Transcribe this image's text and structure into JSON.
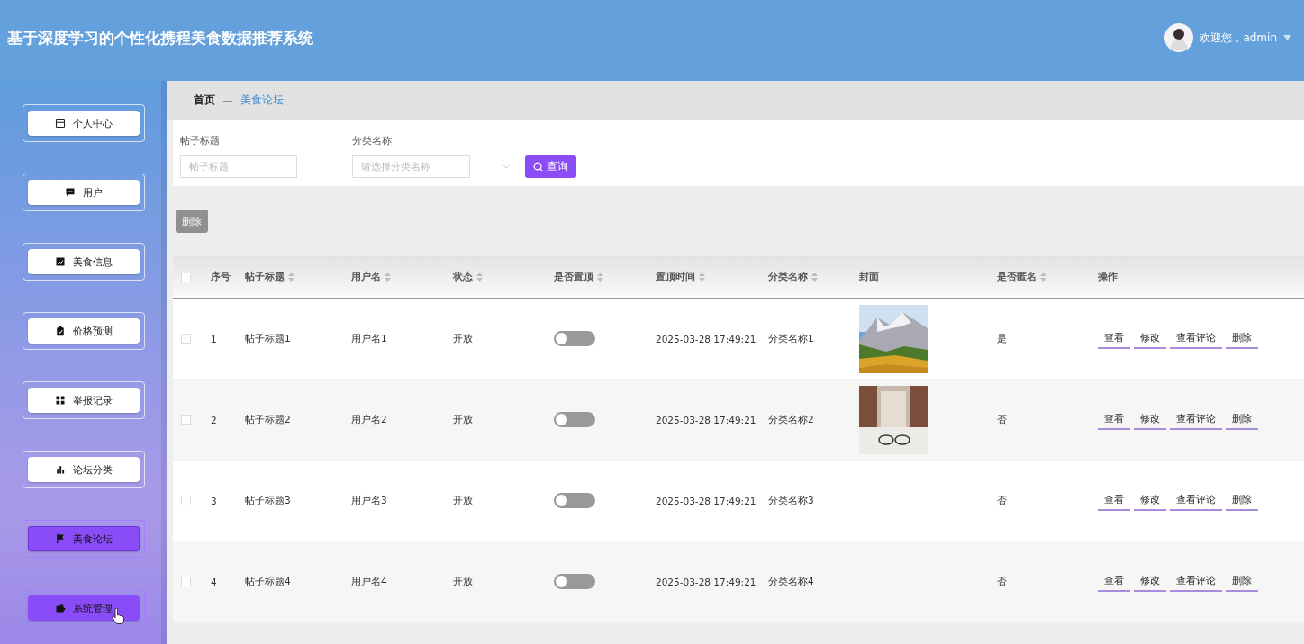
{
  "header": {
    "title": "基于深度学习的个性化携程美食数据推荐系统",
    "greeting": "欢迎您，admin"
  },
  "sidebar": {
    "items": [
      {
        "label": "个人中心",
        "selected": false,
        "hovered": false
      },
      {
        "label": "用户",
        "selected": false,
        "hovered": false
      },
      {
        "label": "美食信息",
        "selected": false,
        "hovered": false
      },
      {
        "label": "价格预测",
        "selected": false,
        "hovered": false
      },
      {
        "label": "举报记录",
        "selected": false,
        "hovered": false
      },
      {
        "label": "论坛分类",
        "selected": false,
        "hovered": false
      },
      {
        "label": "美食论坛",
        "selected": true,
        "hovered": false
      },
      {
        "label": "系统管理",
        "selected": false,
        "hovered": true
      }
    ]
  },
  "breadcrumb": {
    "home": "首页",
    "separator": "—",
    "current": "美食论坛"
  },
  "search": {
    "fields": [
      {
        "label": "帖子标题",
        "placeholder": "帖子标题",
        "kind": "input"
      },
      {
        "label": "分类名称",
        "placeholder": "请选择分类名称",
        "kind": "select"
      }
    ],
    "button": "查询"
  },
  "delete_button": "删除",
  "table": {
    "all_checked": false,
    "columns": [
      {
        "label": "序号",
        "sortable": false
      },
      {
        "label": "帖子标题",
        "sortable": true
      },
      {
        "label": "用户名",
        "sortable": true
      },
      {
        "label": "状态",
        "sortable": true
      },
      {
        "label": "是否置顶",
        "sortable": true
      },
      {
        "label": "置顶时间",
        "sortable": true
      },
      {
        "label": "分类名称",
        "sortable": true
      },
      {
        "label": "封面",
        "sortable": false
      },
      {
        "label": "是否匿名",
        "sortable": true
      },
      {
        "label": "操作",
        "sortable": false
      }
    ],
    "rows": [
      {
        "checked": false,
        "index": "1",
        "title": "帖子标题1",
        "user": "用户名1",
        "status": "开放",
        "pinned": false,
        "time": "2025-03-28 17:49:21",
        "category": "分类名称1",
        "anonymous": "是",
        "actions": [
          "查看",
          "修改",
          "查看评论",
          "删除"
        ]
      },
      {
        "checked": false,
        "index": "2",
        "title": "帖子标题2",
        "user": "用户名2",
        "status": "开放",
        "pinned": false,
        "time": "2025-03-28 17:49:21",
        "category": "分类名称2",
        "anonymous": "否",
        "actions": [
          "查看",
          "修改",
          "查看评论",
          "删除"
        ]
      },
      {
        "checked": false,
        "index": "3",
        "title": "帖子标题3",
        "user": "用户名3",
        "status": "开放",
        "pinned": false,
        "time": "2025-03-28 17:49:21",
        "category": "分类名称3",
        "anonymous": "否",
        "actions": [
          "查看",
          "修改",
          "查看评论",
          "删除"
        ]
      },
      {
        "checked": false,
        "index": "4",
        "title": "帖子标题4",
        "user": "用户名4",
        "status": "开放",
        "pinned": false,
        "time": "2025-03-28 17:49:21",
        "category": "分类名称4",
        "anonymous": "否",
        "actions": [
          "查看",
          "修改",
          "查看评论",
          "删除"
        ]
      }
    ]
  }
}
